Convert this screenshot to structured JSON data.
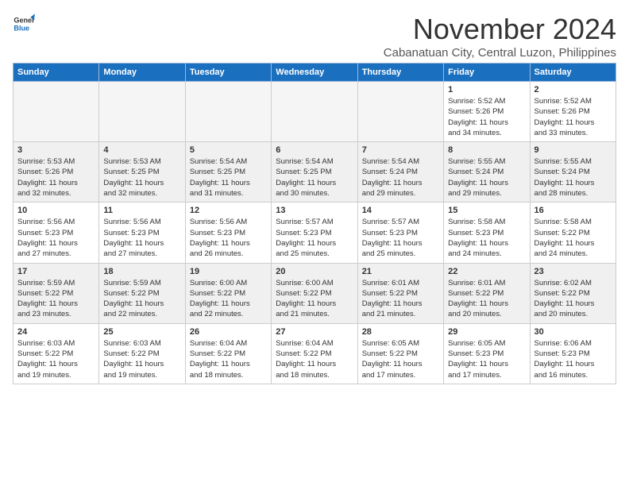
{
  "header": {
    "logo_line1": "General",
    "logo_line2": "Blue",
    "month_title": "November 2024",
    "location": "Cabanatuan City, Central Luzon, Philippines"
  },
  "columns": [
    "Sunday",
    "Monday",
    "Tuesday",
    "Wednesday",
    "Thursday",
    "Friday",
    "Saturday"
  ],
  "weeks": [
    [
      {
        "day": "",
        "info": "",
        "empty": true
      },
      {
        "day": "",
        "info": "",
        "empty": true
      },
      {
        "day": "",
        "info": "",
        "empty": true
      },
      {
        "day": "",
        "info": "",
        "empty": true
      },
      {
        "day": "",
        "info": "",
        "empty": true
      },
      {
        "day": "1",
        "info": "Sunrise: 5:52 AM\nSunset: 5:26 PM\nDaylight: 11 hours\nand 34 minutes."
      },
      {
        "day": "2",
        "info": "Sunrise: 5:52 AM\nSunset: 5:26 PM\nDaylight: 11 hours\nand 33 minutes."
      }
    ],
    [
      {
        "day": "3",
        "info": "Sunrise: 5:53 AM\nSunset: 5:26 PM\nDaylight: 11 hours\nand 32 minutes."
      },
      {
        "day": "4",
        "info": "Sunrise: 5:53 AM\nSunset: 5:25 PM\nDaylight: 11 hours\nand 32 minutes."
      },
      {
        "day": "5",
        "info": "Sunrise: 5:54 AM\nSunset: 5:25 PM\nDaylight: 11 hours\nand 31 minutes."
      },
      {
        "day": "6",
        "info": "Sunrise: 5:54 AM\nSunset: 5:25 PM\nDaylight: 11 hours\nand 30 minutes."
      },
      {
        "day": "7",
        "info": "Sunrise: 5:54 AM\nSunset: 5:24 PM\nDaylight: 11 hours\nand 29 minutes."
      },
      {
        "day": "8",
        "info": "Sunrise: 5:55 AM\nSunset: 5:24 PM\nDaylight: 11 hours\nand 29 minutes."
      },
      {
        "day": "9",
        "info": "Sunrise: 5:55 AM\nSunset: 5:24 PM\nDaylight: 11 hours\nand 28 minutes."
      }
    ],
    [
      {
        "day": "10",
        "info": "Sunrise: 5:56 AM\nSunset: 5:23 PM\nDaylight: 11 hours\nand 27 minutes."
      },
      {
        "day": "11",
        "info": "Sunrise: 5:56 AM\nSunset: 5:23 PM\nDaylight: 11 hours\nand 27 minutes."
      },
      {
        "day": "12",
        "info": "Sunrise: 5:56 AM\nSunset: 5:23 PM\nDaylight: 11 hours\nand 26 minutes."
      },
      {
        "day": "13",
        "info": "Sunrise: 5:57 AM\nSunset: 5:23 PM\nDaylight: 11 hours\nand 25 minutes."
      },
      {
        "day": "14",
        "info": "Sunrise: 5:57 AM\nSunset: 5:23 PM\nDaylight: 11 hours\nand 25 minutes."
      },
      {
        "day": "15",
        "info": "Sunrise: 5:58 AM\nSunset: 5:23 PM\nDaylight: 11 hours\nand 24 minutes."
      },
      {
        "day": "16",
        "info": "Sunrise: 5:58 AM\nSunset: 5:22 PM\nDaylight: 11 hours\nand 24 minutes."
      }
    ],
    [
      {
        "day": "17",
        "info": "Sunrise: 5:59 AM\nSunset: 5:22 PM\nDaylight: 11 hours\nand 23 minutes."
      },
      {
        "day": "18",
        "info": "Sunrise: 5:59 AM\nSunset: 5:22 PM\nDaylight: 11 hours\nand 22 minutes."
      },
      {
        "day": "19",
        "info": "Sunrise: 6:00 AM\nSunset: 5:22 PM\nDaylight: 11 hours\nand 22 minutes."
      },
      {
        "day": "20",
        "info": "Sunrise: 6:00 AM\nSunset: 5:22 PM\nDaylight: 11 hours\nand 21 minutes."
      },
      {
        "day": "21",
        "info": "Sunrise: 6:01 AM\nSunset: 5:22 PM\nDaylight: 11 hours\nand 21 minutes."
      },
      {
        "day": "22",
        "info": "Sunrise: 6:01 AM\nSunset: 5:22 PM\nDaylight: 11 hours\nand 20 minutes."
      },
      {
        "day": "23",
        "info": "Sunrise: 6:02 AM\nSunset: 5:22 PM\nDaylight: 11 hours\nand 20 minutes."
      }
    ],
    [
      {
        "day": "24",
        "info": "Sunrise: 6:03 AM\nSunset: 5:22 PM\nDaylight: 11 hours\nand 19 minutes."
      },
      {
        "day": "25",
        "info": "Sunrise: 6:03 AM\nSunset: 5:22 PM\nDaylight: 11 hours\nand 19 minutes."
      },
      {
        "day": "26",
        "info": "Sunrise: 6:04 AM\nSunset: 5:22 PM\nDaylight: 11 hours\nand 18 minutes."
      },
      {
        "day": "27",
        "info": "Sunrise: 6:04 AM\nSunset: 5:22 PM\nDaylight: 11 hours\nand 18 minutes."
      },
      {
        "day": "28",
        "info": "Sunrise: 6:05 AM\nSunset: 5:22 PM\nDaylight: 11 hours\nand 17 minutes."
      },
      {
        "day": "29",
        "info": "Sunrise: 6:05 AM\nSunset: 5:23 PM\nDaylight: 11 hours\nand 17 minutes."
      },
      {
        "day": "30",
        "info": "Sunrise: 6:06 AM\nSunset: 5:23 PM\nDaylight: 11 hours\nand 16 minutes."
      }
    ]
  ]
}
